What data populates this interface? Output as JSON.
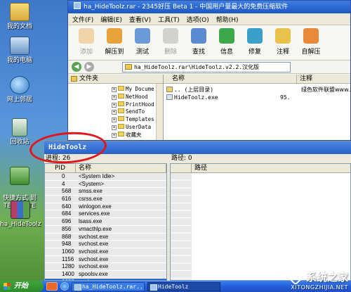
{
  "desktop": {
    "icons": [
      {
        "label": "我的文档"
      },
      {
        "label": "我的电脑"
      },
      {
        "label": "网上邻居"
      },
      {
        "label": "回收站"
      },
      {
        "label": "快捷方式 到\nTEMPLATE"
      },
      {
        "label": "ha_HideToolz"
      }
    ]
  },
  "rar_window": {
    "title": "ha_HideToolz.rar - 2345好压 Beta 1 - 中国用户量最大的免费压缩软件",
    "menu": [
      "文件(F)",
      "编辑(E)",
      "查看(V)",
      "工具(T)",
      "选项(O)",
      "帮助(H)"
    ],
    "toolbar": [
      {
        "label": "添加",
        "icon": "add-icon",
        "color": "#e8a23c",
        "enabled": false
      },
      {
        "label": "解压到",
        "icon": "extract-to-icon",
        "color": "#e8a23c",
        "enabled": true
      },
      {
        "label": "测试",
        "icon": "test-icon",
        "color": "#6a9ad8",
        "enabled": true
      },
      {
        "label": "删除",
        "icon": "delete-icon",
        "color": "#999999",
        "enabled": false
      },
      {
        "label": "查找",
        "icon": "search-icon",
        "color": "#5a8ad0",
        "enabled": true
      },
      {
        "label": "信息",
        "icon": "info-icon",
        "color": "#3ca84a",
        "enabled": true
      },
      {
        "label": "修复",
        "icon": "repair-icon",
        "color": "#3aa0c8",
        "enabled": true
      },
      {
        "label": "注释",
        "icon": "comment-icon",
        "color": "#e8c24a",
        "enabled": true
      },
      {
        "label": "自解压",
        "icon": "sfx-icon",
        "color": "#e88a3a",
        "enabled": true
      }
    ],
    "address": "ha_HideToolz.rar\\HideToolz.v2.2.汉化版",
    "tree_header": "文件夹",
    "tree_items": [
      "My Docume",
      "NetHood",
      "PrintHood",
      "SendTo",
      "Templates",
      "UserData",
      "收藏夹"
    ],
    "file_columns": [
      "名称",
      "注释"
    ],
    "files": [
      {
        "name": ".. (上层目录)",
        "size": ""
      },
      {
        "name": "HideToolz.exe",
        "size": "95."
      }
    ],
    "comment_text": "绿色软件联盟www.xd"
  },
  "hidetoolz": {
    "title": "HideToolz",
    "process_count_label": "进程: 26",
    "path_label": "路径: 0",
    "columns": {
      "pid": "PID",
      "name": "名称",
      "path": "路径"
    },
    "processes": [
      {
        "pid": "0",
        "name": "<System Idle>"
      },
      {
        "pid": "4",
        "name": "<System>"
      },
      {
        "pid": "568",
        "name": "smss.exe"
      },
      {
        "pid": "616",
        "name": "csrss.exe"
      },
      {
        "pid": "640",
        "name": "winlogon.exe"
      },
      {
        "pid": "684",
        "name": "services.exe"
      },
      {
        "pid": "696",
        "name": "lsass.exe"
      },
      {
        "pid": "856",
        "name": "vmacthlp.exe"
      },
      {
        "pid": "868",
        "name": "svchost.exe"
      },
      {
        "pid": "948",
        "name": "svchost.exe"
      },
      {
        "pid": "1060",
        "name": "svchost.exe"
      },
      {
        "pid": "1156",
        "name": "svchost.exe"
      },
      {
        "pid": "1280",
        "name": "svchost.exe"
      },
      {
        "pid": "1400",
        "name": "spoolsv.exe"
      },
      {
        "pid": "1668",
        "name": "explorer.exe",
        "selected": true
      }
    ]
  },
  "taskbar": {
    "start_label": "开始",
    "tasks": [
      {
        "label": "ha_HideToolz.rar..."
      },
      {
        "label": "HideToolz"
      }
    ]
  },
  "watermark": {
    "line1": "系统之家",
    "line2": "XITONGZHIJIA.NET"
  }
}
